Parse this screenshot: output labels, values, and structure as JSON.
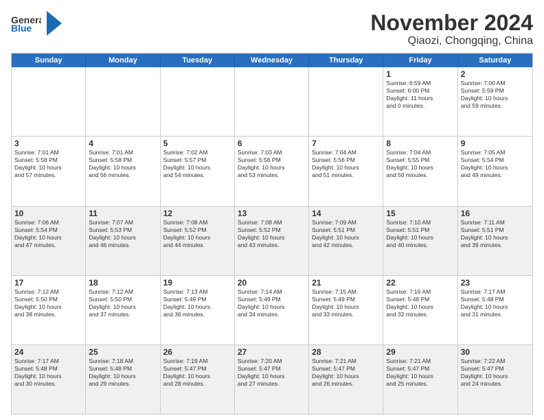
{
  "header": {
    "logo_general": "General",
    "logo_blue": "Blue",
    "month": "November 2024",
    "location": "Qiaozi, Chongqing, China"
  },
  "calendar": {
    "days_of_week": [
      "Sunday",
      "Monday",
      "Tuesday",
      "Wednesday",
      "Thursday",
      "Friday",
      "Saturday"
    ],
    "weeks": [
      [
        {
          "day": "",
          "info": ""
        },
        {
          "day": "",
          "info": ""
        },
        {
          "day": "",
          "info": ""
        },
        {
          "day": "",
          "info": ""
        },
        {
          "day": "",
          "info": ""
        },
        {
          "day": "1",
          "info": "Sunrise: 6:59 AM\nSunset: 6:00 PM\nDaylight: 11 hours\nand 0 minutes."
        },
        {
          "day": "2",
          "info": "Sunrise: 7:00 AM\nSunset: 5:59 PM\nDaylight: 10 hours\nand 59 minutes."
        }
      ],
      [
        {
          "day": "3",
          "info": "Sunrise: 7:01 AM\nSunset: 5:58 PM\nDaylight: 10 hours\nand 57 minutes."
        },
        {
          "day": "4",
          "info": "Sunrise: 7:01 AM\nSunset: 5:58 PM\nDaylight: 10 hours\nand 56 minutes."
        },
        {
          "day": "5",
          "info": "Sunrise: 7:02 AM\nSunset: 5:57 PM\nDaylight: 10 hours\nand 54 minutes."
        },
        {
          "day": "6",
          "info": "Sunrise: 7:03 AM\nSunset: 5:56 PM\nDaylight: 10 hours\nand 53 minutes."
        },
        {
          "day": "7",
          "info": "Sunrise: 7:04 AM\nSunset: 5:56 PM\nDaylight: 10 hours\nand 51 minutes."
        },
        {
          "day": "8",
          "info": "Sunrise: 7:04 AM\nSunset: 5:55 PM\nDaylight: 10 hours\nand 50 minutes."
        },
        {
          "day": "9",
          "info": "Sunrise: 7:05 AM\nSunset: 5:54 PM\nDaylight: 10 hours\nand 49 minutes."
        }
      ],
      [
        {
          "day": "10",
          "info": "Sunrise: 7:06 AM\nSunset: 5:54 PM\nDaylight: 10 hours\nand 47 minutes."
        },
        {
          "day": "11",
          "info": "Sunrise: 7:07 AM\nSunset: 5:53 PM\nDaylight: 10 hours\nand 46 minutes."
        },
        {
          "day": "12",
          "info": "Sunrise: 7:08 AM\nSunset: 5:52 PM\nDaylight: 10 hours\nand 44 minutes."
        },
        {
          "day": "13",
          "info": "Sunrise: 7:08 AM\nSunset: 5:52 PM\nDaylight: 10 hours\nand 43 minutes."
        },
        {
          "day": "14",
          "info": "Sunrise: 7:09 AM\nSunset: 5:51 PM\nDaylight: 10 hours\nand 42 minutes."
        },
        {
          "day": "15",
          "info": "Sunrise: 7:10 AM\nSunset: 5:51 PM\nDaylight: 10 hours\nand 40 minutes."
        },
        {
          "day": "16",
          "info": "Sunrise: 7:11 AM\nSunset: 5:51 PM\nDaylight: 10 hours\nand 39 minutes."
        }
      ],
      [
        {
          "day": "17",
          "info": "Sunrise: 7:12 AM\nSunset: 5:50 PM\nDaylight: 10 hours\nand 38 minutes."
        },
        {
          "day": "18",
          "info": "Sunrise: 7:12 AM\nSunset: 5:50 PM\nDaylight: 10 hours\nand 37 minutes."
        },
        {
          "day": "19",
          "info": "Sunrise: 7:13 AM\nSunset: 5:49 PM\nDaylight: 10 hours\nand 36 minutes."
        },
        {
          "day": "20",
          "info": "Sunrise: 7:14 AM\nSunset: 5:49 PM\nDaylight: 10 hours\nand 34 minutes."
        },
        {
          "day": "21",
          "info": "Sunrise: 7:15 AM\nSunset: 5:49 PM\nDaylight: 10 hours\nand 33 minutes."
        },
        {
          "day": "22",
          "info": "Sunrise: 7:16 AM\nSunset: 5:48 PM\nDaylight: 10 hours\nand 32 minutes."
        },
        {
          "day": "23",
          "info": "Sunrise: 7:17 AM\nSunset: 5:48 PM\nDaylight: 10 hours\nand 31 minutes."
        }
      ],
      [
        {
          "day": "24",
          "info": "Sunrise: 7:17 AM\nSunset: 5:48 PM\nDaylight: 10 hours\nand 30 minutes."
        },
        {
          "day": "25",
          "info": "Sunrise: 7:18 AM\nSunset: 5:48 PM\nDaylight: 10 hours\nand 29 minutes."
        },
        {
          "day": "26",
          "info": "Sunrise: 7:19 AM\nSunset: 5:47 PM\nDaylight: 10 hours\nand 28 minutes."
        },
        {
          "day": "27",
          "info": "Sunrise: 7:20 AM\nSunset: 5:47 PM\nDaylight: 10 hours\nand 27 minutes."
        },
        {
          "day": "28",
          "info": "Sunrise: 7:21 AM\nSunset: 5:47 PM\nDaylight: 10 hours\nand 26 minutes."
        },
        {
          "day": "29",
          "info": "Sunrise: 7:21 AM\nSunset: 5:47 PM\nDaylight: 10 hours\nand 25 minutes."
        },
        {
          "day": "30",
          "info": "Sunrise: 7:22 AM\nSunset: 5:47 PM\nDaylight: 10 hours\nand 24 minutes."
        }
      ]
    ]
  }
}
